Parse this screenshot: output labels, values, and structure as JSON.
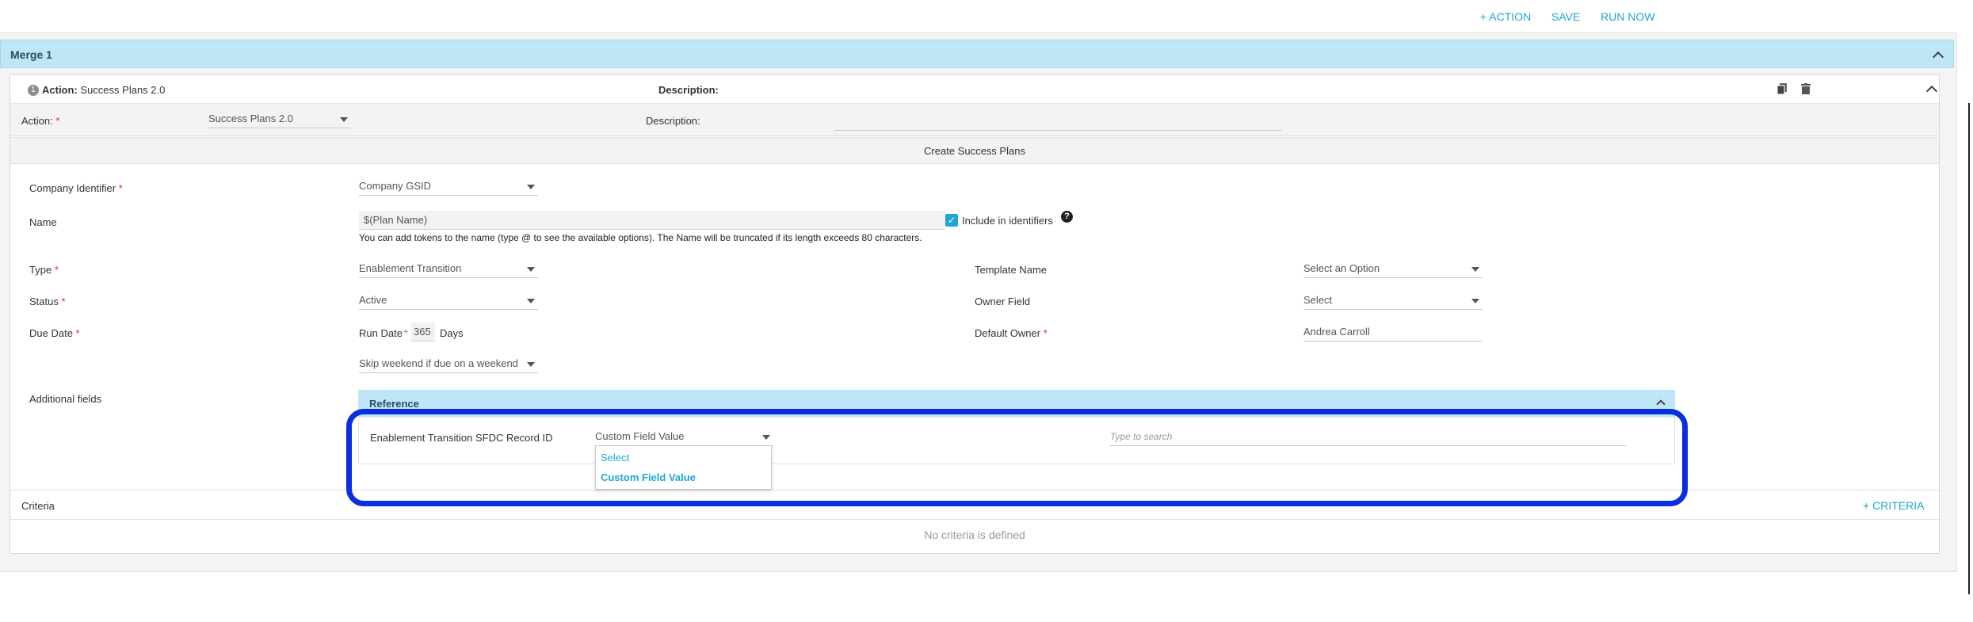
{
  "toolbar": {
    "add_action": "+ ACTION",
    "save": "SAVE",
    "run_now": "RUN NOW"
  },
  "merge": {
    "title": "Merge 1"
  },
  "action_card": {
    "badge": "1",
    "action_prefix": "Action:",
    "action_name": "Success Plans 2.0",
    "description_label": "Description:",
    "icons": [
      "copy-icon",
      "trash-icon",
      "chevron-up-icon"
    ]
  },
  "action_row": {
    "action_label": "Action:",
    "action_value": "Success Plans 2.0",
    "description_label": "Description:",
    "description_value": ""
  },
  "section_title": "Create Success Plans",
  "fields": {
    "company_identifier": {
      "label": "Company Identifier",
      "value": "Company GSID"
    },
    "name": {
      "label": "Name",
      "value": "$(Plan Name)",
      "include_label": "Include in identifiers",
      "include_checked": true,
      "hint": "You can add tokens to the name (type @ to see the available options). The Name will be truncated if its length exceeds 80 characters."
    },
    "type": {
      "label": "Type",
      "value": "Enablement Transition"
    },
    "status": {
      "label": "Status",
      "value": "Active"
    },
    "due_date": {
      "label": "Due Date",
      "base": "Run Date",
      "operator": "+",
      "offset": "365",
      "unit": "Days",
      "weekend_option": "Skip weekend if due on a weekend"
    },
    "template_name": {
      "label": "Template Name",
      "value": "Select an Option"
    },
    "owner_field": {
      "label": "Owner Field",
      "value": "Select"
    },
    "default_owner": {
      "label": "Default Owner",
      "value": "Andrea Carroll"
    },
    "additional_fields": {
      "label": "Additional fields"
    }
  },
  "reference": {
    "title": "Reference",
    "row_label": "Enablement Transition SFDC Record ID",
    "type_value": "Custom Field Value",
    "search_placeholder": "Type to search",
    "dropdown_options": [
      "Select",
      "Custom Field Value"
    ]
  },
  "criteria": {
    "label": "Criteria",
    "add_label": "+ CRITERIA",
    "empty_text": "No criteria is defined"
  },
  "colors": {
    "accent": "#1ea7d6",
    "merge_bar": "#bfe6f7",
    "required": "#e4262f",
    "highlight": "#0a2ee0"
  }
}
